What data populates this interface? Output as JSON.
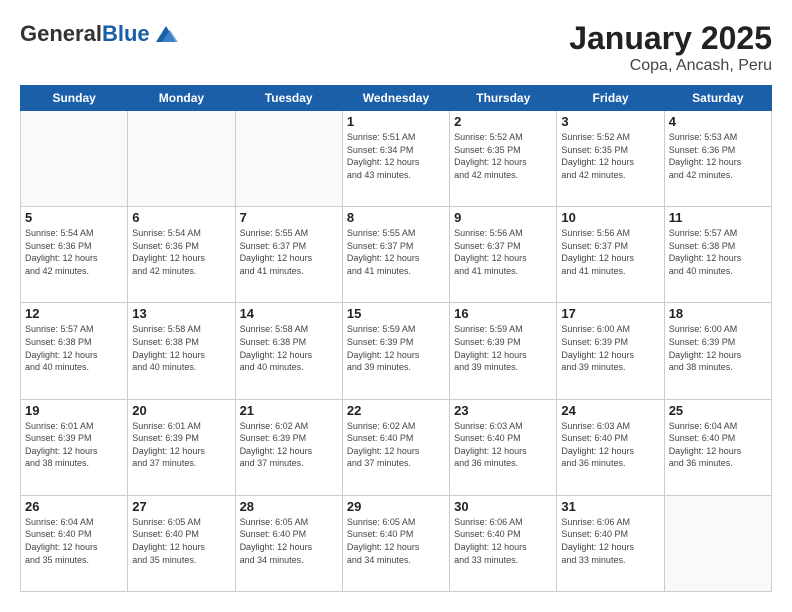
{
  "logo": {
    "general": "General",
    "blue": "Blue"
  },
  "header": {
    "title": "January 2025",
    "subtitle": "Copa, Ancash, Peru"
  },
  "weekdays": [
    "Sunday",
    "Monday",
    "Tuesday",
    "Wednesday",
    "Thursday",
    "Friday",
    "Saturday"
  ],
  "weeks": [
    [
      {
        "day": "",
        "info": ""
      },
      {
        "day": "",
        "info": ""
      },
      {
        "day": "",
        "info": ""
      },
      {
        "day": "1",
        "info": "Sunrise: 5:51 AM\nSunset: 6:34 PM\nDaylight: 12 hours\nand 43 minutes."
      },
      {
        "day": "2",
        "info": "Sunrise: 5:52 AM\nSunset: 6:35 PM\nDaylight: 12 hours\nand 42 minutes."
      },
      {
        "day": "3",
        "info": "Sunrise: 5:52 AM\nSunset: 6:35 PM\nDaylight: 12 hours\nand 42 minutes."
      },
      {
        "day": "4",
        "info": "Sunrise: 5:53 AM\nSunset: 6:36 PM\nDaylight: 12 hours\nand 42 minutes."
      }
    ],
    [
      {
        "day": "5",
        "info": "Sunrise: 5:54 AM\nSunset: 6:36 PM\nDaylight: 12 hours\nand 42 minutes."
      },
      {
        "day": "6",
        "info": "Sunrise: 5:54 AM\nSunset: 6:36 PM\nDaylight: 12 hours\nand 42 minutes."
      },
      {
        "day": "7",
        "info": "Sunrise: 5:55 AM\nSunset: 6:37 PM\nDaylight: 12 hours\nand 41 minutes."
      },
      {
        "day": "8",
        "info": "Sunrise: 5:55 AM\nSunset: 6:37 PM\nDaylight: 12 hours\nand 41 minutes."
      },
      {
        "day": "9",
        "info": "Sunrise: 5:56 AM\nSunset: 6:37 PM\nDaylight: 12 hours\nand 41 minutes."
      },
      {
        "day": "10",
        "info": "Sunrise: 5:56 AM\nSunset: 6:37 PM\nDaylight: 12 hours\nand 41 minutes."
      },
      {
        "day": "11",
        "info": "Sunrise: 5:57 AM\nSunset: 6:38 PM\nDaylight: 12 hours\nand 40 minutes."
      }
    ],
    [
      {
        "day": "12",
        "info": "Sunrise: 5:57 AM\nSunset: 6:38 PM\nDaylight: 12 hours\nand 40 minutes."
      },
      {
        "day": "13",
        "info": "Sunrise: 5:58 AM\nSunset: 6:38 PM\nDaylight: 12 hours\nand 40 minutes."
      },
      {
        "day": "14",
        "info": "Sunrise: 5:58 AM\nSunset: 6:38 PM\nDaylight: 12 hours\nand 40 minutes."
      },
      {
        "day": "15",
        "info": "Sunrise: 5:59 AM\nSunset: 6:39 PM\nDaylight: 12 hours\nand 39 minutes."
      },
      {
        "day": "16",
        "info": "Sunrise: 5:59 AM\nSunset: 6:39 PM\nDaylight: 12 hours\nand 39 minutes."
      },
      {
        "day": "17",
        "info": "Sunrise: 6:00 AM\nSunset: 6:39 PM\nDaylight: 12 hours\nand 39 minutes."
      },
      {
        "day": "18",
        "info": "Sunrise: 6:00 AM\nSunset: 6:39 PM\nDaylight: 12 hours\nand 38 minutes."
      }
    ],
    [
      {
        "day": "19",
        "info": "Sunrise: 6:01 AM\nSunset: 6:39 PM\nDaylight: 12 hours\nand 38 minutes."
      },
      {
        "day": "20",
        "info": "Sunrise: 6:01 AM\nSunset: 6:39 PM\nDaylight: 12 hours\nand 37 minutes."
      },
      {
        "day": "21",
        "info": "Sunrise: 6:02 AM\nSunset: 6:39 PM\nDaylight: 12 hours\nand 37 minutes."
      },
      {
        "day": "22",
        "info": "Sunrise: 6:02 AM\nSunset: 6:40 PM\nDaylight: 12 hours\nand 37 minutes."
      },
      {
        "day": "23",
        "info": "Sunrise: 6:03 AM\nSunset: 6:40 PM\nDaylight: 12 hours\nand 36 minutes."
      },
      {
        "day": "24",
        "info": "Sunrise: 6:03 AM\nSunset: 6:40 PM\nDaylight: 12 hours\nand 36 minutes."
      },
      {
        "day": "25",
        "info": "Sunrise: 6:04 AM\nSunset: 6:40 PM\nDaylight: 12 hours\nand 36 minutes."
      }
    ],
    [
      {
        "day": "26",
        "info": "Sunrise: 6:04 AM\nSunset: 6:40 PM\nDaylight: 12 hours\nand 35 minutes."
      },
      {
        "day": "27",
        "info": "Sunrise: 6:05 AM\nSunset: 6:40 PM\nDaylight: 12 hours\nand 35 minutes."
      },
      {
        "day": "28",
        "info": "Sunrise: 6:05 AM\nSunset: 6:40 PM\nDaylight: 12 hours\nand 34 minutes."
      },
      {
        "day": "29",
        "info": "Sunrise: 6:05 AM\nSunset: 6:40 PM\nDaylight: 12 hours\nand 34 minutes."
      },
      {
        "day": "30",
        "info": "Sunrise: 6:06 AM\nSunset: 6:40 PM\nDaylight: 12 hours\nand 33 minutes."
      },
      {
        "day": "31",
        "info": "Sunrise: 6:06 AM\nSunset: 6:40 PM\nDaylight: 12 hours\nand 33 minutes."
      },
      {
        "day": "",
        "info": ""
      }
    ]
  ]
}
